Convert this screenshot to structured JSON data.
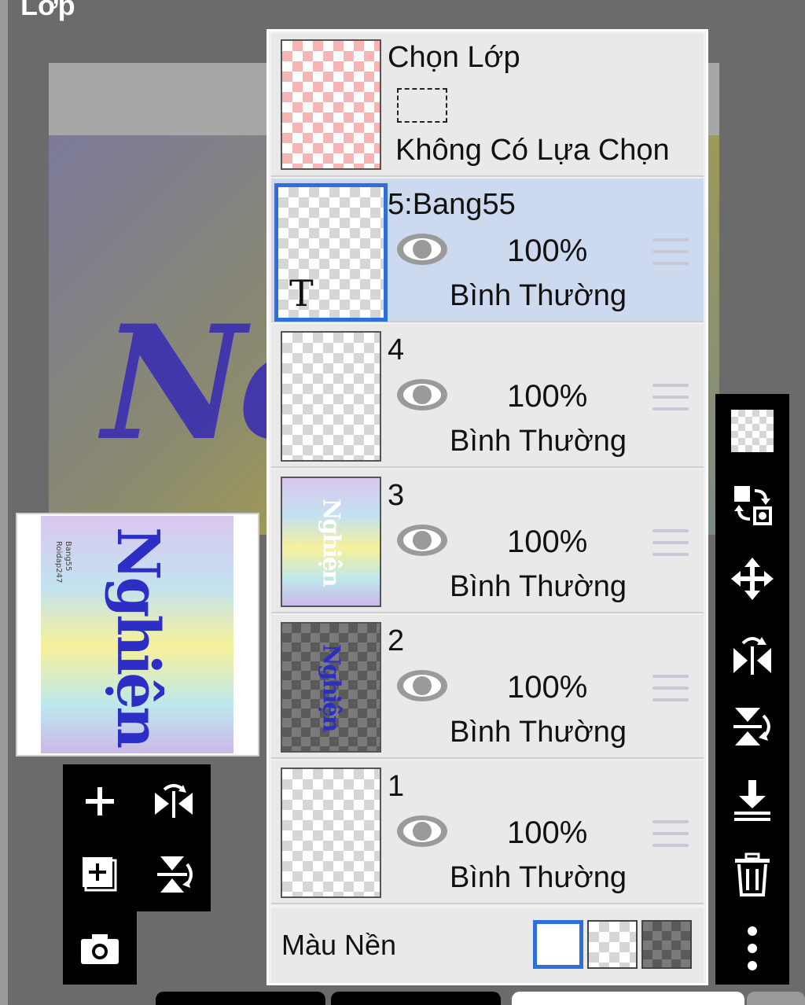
{
  "header": {
    "title": "Lớp"
  },
  "preview": {
    "credit_lines": [
      "Bang55",
      "Roidap247"
    ],
    "word": "Nghiện"
  },
  "canvas": {
    "word_fragment": "Ne"
  },
  "selection_layer": {
    "title": "Chọn Lớp",
    "status": "Không Có Lựa Chọn"
  },
  "layers": [
    {
      "name": "5:Bang55",
      "opacity": "100%",
      "blend": "Bình Thường",
      "thumb": "T",
      "active": true
    },
    {
      "name": "4",
      "opacity": "100%",
      "blend": "Bình Thường"
    },
    {
      "name": "3",
      "opacity": "100%",
      "blend": "Bình Thường",
      "thumb_word": "Nghiện"
    },
    {
      "name": "2",
      "opacity": "100%",
      "blend": "Bình Thường",
      "thumb_word": "Nghiện"
    },
    {
      "name": "1",
      "opacity": "100%",
      "blend": "Bình Thường"
    }
  ],
  "background": {
    "label": "Màu Nền",
    "options": [
      "white",
      "transparent",
      "dark-checker"
    ],
    "selected": "white"
  },
  "left_tools": [
    "add-layer",
    "flip-horizontal",
    "add-copy-layer",
    "flip-vertical",
    "camera"
  ],
  "right_tools": [
    "transparency",
    "swap",
    "move",
    "flip-horizontal",
    "flip-vertical",
    "merge-down",
    "delete",
    "more"
  ],
  "colors": {
    "accent": "#2f6fdc",
    "active_row": "#cdd9ee",
    "toolbar": "#000000"
  }
}
